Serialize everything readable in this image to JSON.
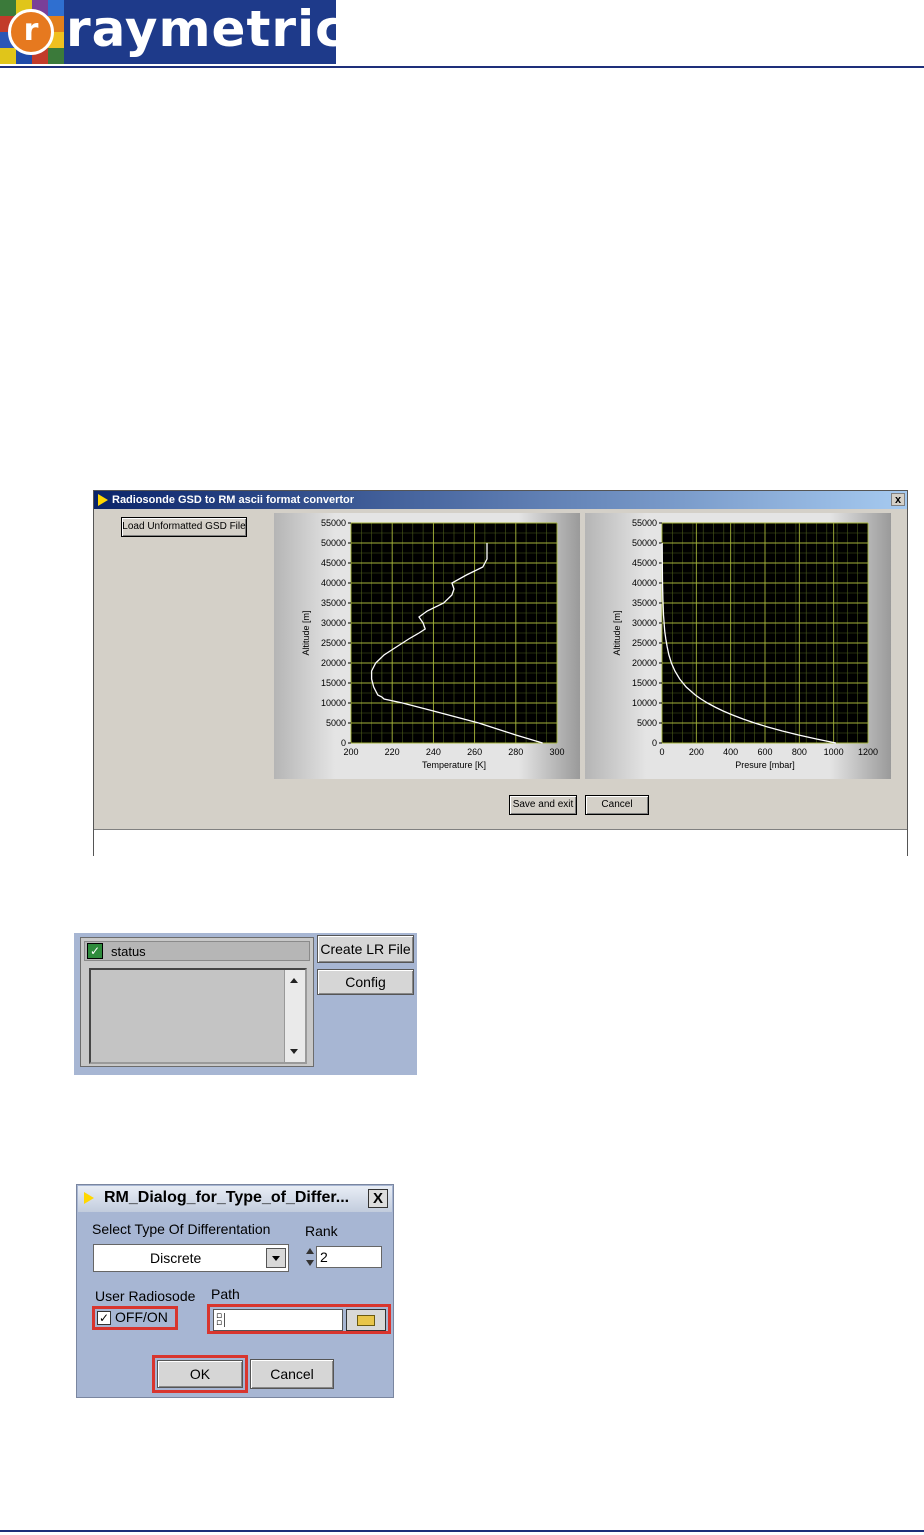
{
  "logo": {
    "letter": "r",
    "wordmark": "raymetrics"
  },
  "converter_window": {
    "title": "Radiosonde GSD to RM ascii format convertor",
    "close_label": "x",
    "load_button": "Load Unformatted GSD File",
    "save_button": "Save and exit",
    "cancel_button": "Cancel"
  },
  "status_panel": {
    "label": "status",
    "create_button": "Create LR File",
    "config_button": "Config"
  },
  "dialog": {
    "title": "RM_Dialog_for_Type_of_Differ...",
    "close_label": "X",
    "type_label": "Select Type Of Differentation",
    "type_value": "Discrete",
    "rank_label": "Rank",
    "rank_value": "2",
    "radiosode_label": "User Radiosode",
    "toggle_label": "OFF/ON",
    "path_label": "Path",
    "path_value": "",
    "ok_button": "OK",
    "cancel_button": "Cancel",
    "highlight_color": "#d8352e"
  },
  "chart_data": [
    {
      "type": "line",
      "xlabel": "Temperature [K]",
      "ylabel": "Altitude [m]",
      "xlim": [
        200,
        300
      ],
      "ylim": [
        0,
        55000
      ],
      "xticks": [
        "200",
        "220",
        "240",
        "260",
        "280",
        "300"
      ],
      "yticks": [
        "0",
        "5000",
        "10000",
        "15000",
        "20000",
        "25000",
        "30000",
        "35000",
        "40000",
        "45000",
        "50000",
        "55000"
      ],
      "grid": true,
      "series": [
        {
          "x": [
            293,
            280,
            262,
            240,
            225,
            216,
            215,
            213,
            211,
            210,
            210,
            212,
            216,
            222,
            228,
            233,
            236,
            235,
            233,
            237,
            245,
            249,
            250,
            249,
            256,
            264,
            266,
            266
          ],
          "y": [
            0,
            2000,
            5000,
            8000,
            10000,
            11000,
            11500,
            12000,
            14000,
            16000,
            18000,
            20000,
            22000,
            24000,
            26000,
            27500,
            28500,
            30000,
            31500,
            33000,
            35000,
            37000,
            38500,
            40000,
            42000,
            44000,
            46000,
            50000
          ]
        }
      ]
    },
    {
      "type": "line",
      "xlabel": "Presure [mbar]",
      "ylabel": "Altitude [m]",
      "xlim": [
        0,
        1200
      ],
      "ylim": [
        0,
        55000
      ],
      "xticks": [
        "0",
        "200",
        "400",
        "600",
        "800",
        "1000",
        "1200"
      ],
      "yticks": [
        "0",
        "5000",
        "10000",
        "15000",
        "20000",
        "25000",
        "30000",
        "35000",
        "40000",
        "45000",
        "50000",
        "55000"
      ],
      "grid": true,
      "series": [
        {
          "x": [
            1013,
            900,
            795,
            701,
            616,
            540,
            472,
            411,
            356,
            308,
            265,
            227,
            194,
            141,
            103,
            75,
            55,
            40,
            30,
            22,
            16,
            12,
            9,
            7,
            5,
            3,
            2,
            1
          ],
          "y": [
            0,
            1000,
            2000,
            3000,
            4000,
            5000,
            6000,
            7000,
            8000,
            9000,
            10000,
            11000,
            12000,
            14000,
            16000,
            18000,
            20000,
            22000,
            24000,
            26000,
            28000,
            30000,
            32000,
            34000,
            36000,
            40000,
            45000,
            50000
          ]
        }
      ]
    }
  ]
}
